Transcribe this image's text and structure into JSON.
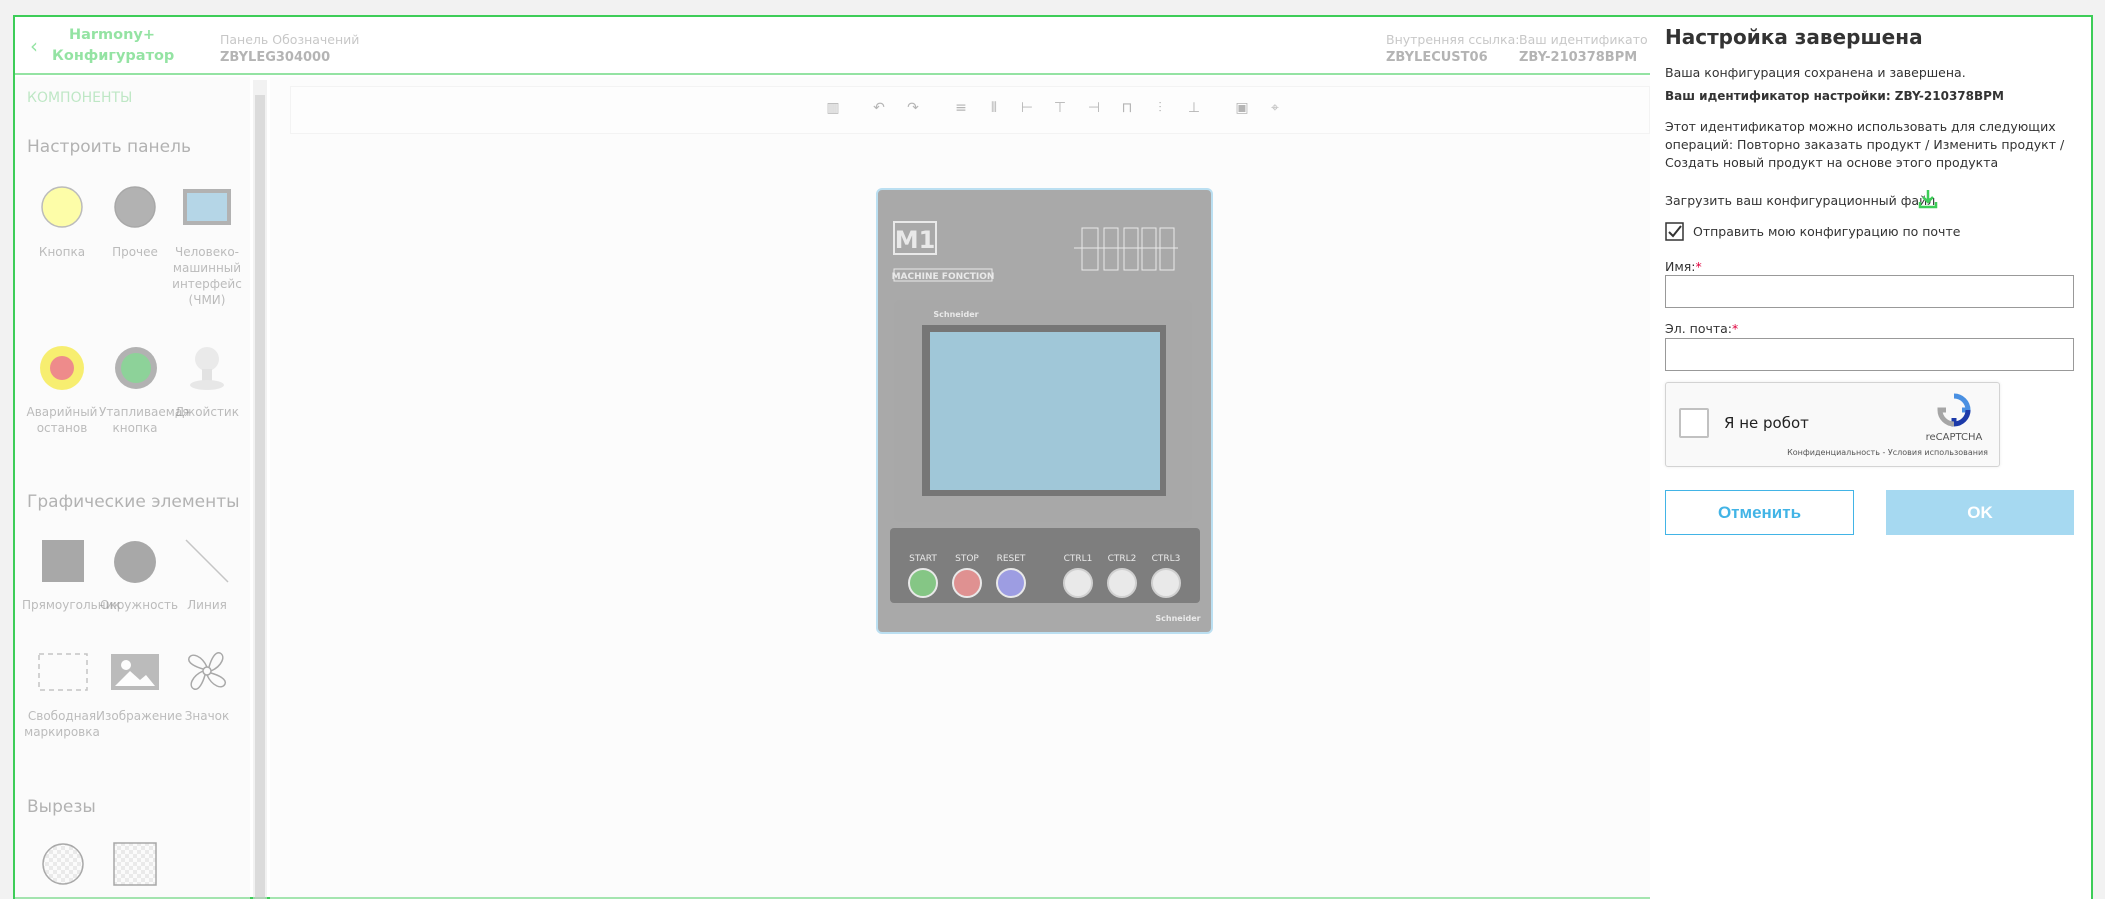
{
  "app": {
    "brand_line1": "Harmony+",
    "brand_line2": "Конфигуратор",
    "panel_label": "Панель Обозначений",
    "panel_value": "ZBYLEG304000",
    "ref_label": "Внутренняя ссылка:",
    "ref_value": "ZBYLECUST06",
    "id_label": "Ваш идентификатор",
    "id_value": "ZBY-210378BPM"
  },
  "sidebar": {
    "title": "КОМПОНЕНТЫ",
    "sections": {
      "customize": "Настроить панель",
      "graphics": "Графические элементы",
      "cutouts": "Вырезы"
    },
    "items": {
      "button": "Кнопка",
      "other": "Прочее",
      "hmi": "Человеко-машинный интерфейс (ЧМИ)",
      "estop": "Аварийный останов",
      "flush": "Утапливаемая кнопка",
      "joystick": "Джойстик",
      "rect": "Прямоугольник",
      "circle": "Окружность",
      "line": "Линия",
      "free": "Свободная маркировка",
      "image": "Изображение",
      "icon": "Значок"
    }
  },
  "device": {
    "logo": "M1",
    "subtitle": "MACHINE FONCTION",
    "brand": "Schneider",
    "buttons": [
      "START",
      "STOP",
      "RESET",
      "CTRL1",
      "CTRL2",
      "CTRL3"
    ]
  },
  "dialog": {
    "title": "Настройка завершена",
    "saved": "Ваша конфигурация сохранена и завершена.",
    "id_line": "Ваш идентификатор настройки: ZBY-210378BPM",
    "usage": "Этот идентификатор можно использовать для следующих операций: Повторно заказать продукт / Изменить продукт / Создать новый продукт на основе этого продукта",
    "download": "Загрузить ваш конфигурационный файл",
    "email_checkbox": "Отправить мою конфигурацию по почте",
    "name_label": "Имя:",
    "email_label": "Эл. почта:",
    "required_mark": "*",
    "captcha_label": "Я не робот",
    "captcha_brand": "reCAPTCHA",
    "captcha_links": "Конфиденциальность - Условия использования",
    "cancel": "Отменить",
    "ok": "OK"
  },
  "colors": {
    "accent": "#3dcd58",
    "link": "#42b4e6",
    "required": "#e1003e"
  }
}
